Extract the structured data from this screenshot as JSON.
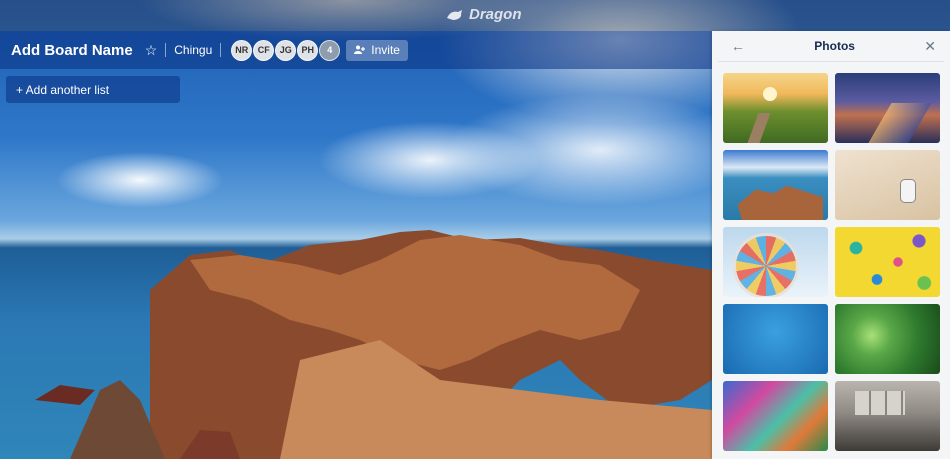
{
  "app": {
    "logo_text": "Dragon"
  },
  "board": {
    "title": "Add Board Name",
    "team": "Chingu",
    "members": [
      "NR",
      "CF",
      "JG",
      "PH"
    ],
    "extra_members": "4",
    "invite_label": "Invite"
  },
  "lists": {
    "add_label": "+ Add another list"
  },
  "panel": {
    "title": "Photos",
    "photos": [
      "sunrise-meadow-path",
      "city-street-dusk",
      "coastal-cliffs",
      "stormtrooper-sand",
      "ferris-wheel",
      "toy-animals-yellow",
      "blue-texture",
      "succulent-green",
      "abstract-paint",
      "brick-wall-gravel"
    ]
  }
}
